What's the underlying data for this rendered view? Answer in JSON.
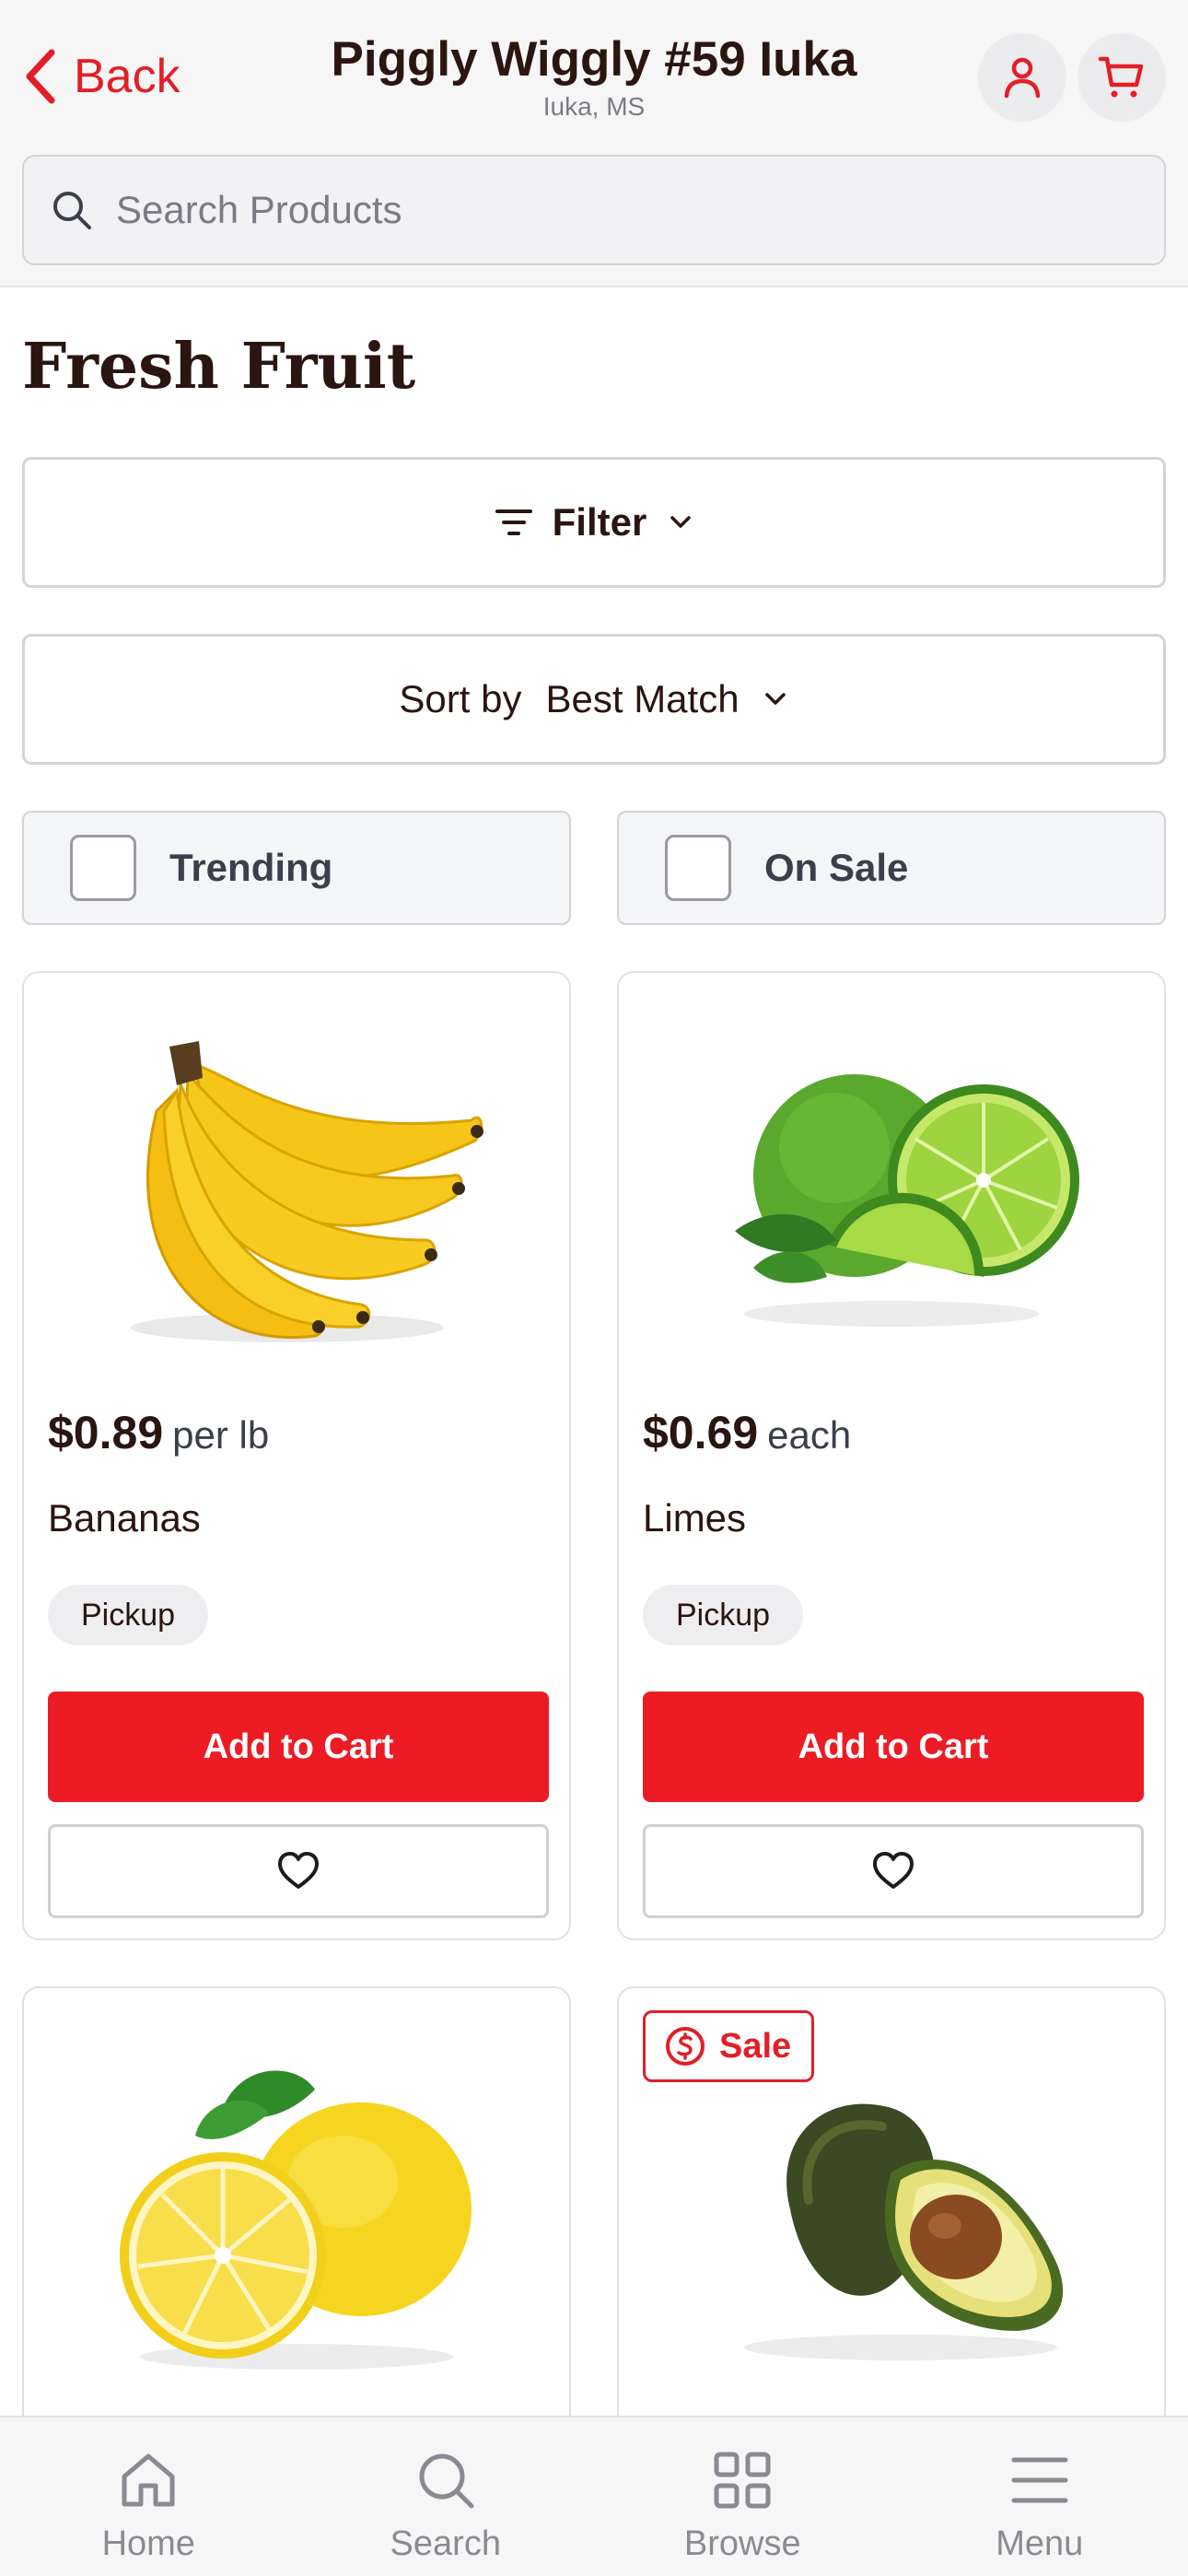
{
  "header": {
    "back_label": "Back",
    "store_name": "Piggly Wiggly #59 Iuka",
    "store_location": "Iuka, MS",
    "search_placeholder": "Search Products"
  },
  "main": {
    "title": "Fresh Fruit",
    "filter_label": "Filter",
    "sort_prefix": "Sort by",
    "sort_value": "Best Match",
    "toggles": [
      {
        "label": "Trending",
        "checked": false
      },
      {
        "label": "On Sale",
        "checked": false
      }
    ]
  },
  "products": [
    {
      "name": "Bananas",
      "price": "$0.89",
      "unit": "per lb",
      "tag": "Pickup",
      "add_label": "Add to Cart",
      "image": "banana-image"
    },
    {
      "name": "Limes",
      "price": "$0.69",
      "unit": "each",
      "tag": "Pickup",
      "add_label": "Add to Cart",
      "image": "lime-image"
    },
    {
      "name": "",
      "image": "lemon-image"
    },
    {
      "name": "",
      "badge": "Sale",
      "image": "avocado-image"
    }
  ],
  "nav": {
    "items": [
      {
        "label": "Home",
        "icon": "home-icon"
      },
      {
        "label": "Search",
        "icon": "search-icon"
      },
      {
        "label": "Browse",
        "icon": "grid-icon"
      },
      {
        "label": "Menu",
        "icon": "menu-icon"
      }
    ]
  },
  "colors": {
    "brand_red": "#ed1c24",
    "title_brown": "#2b1510",
    "muted_gray": "#8a8a93"
  }
}
